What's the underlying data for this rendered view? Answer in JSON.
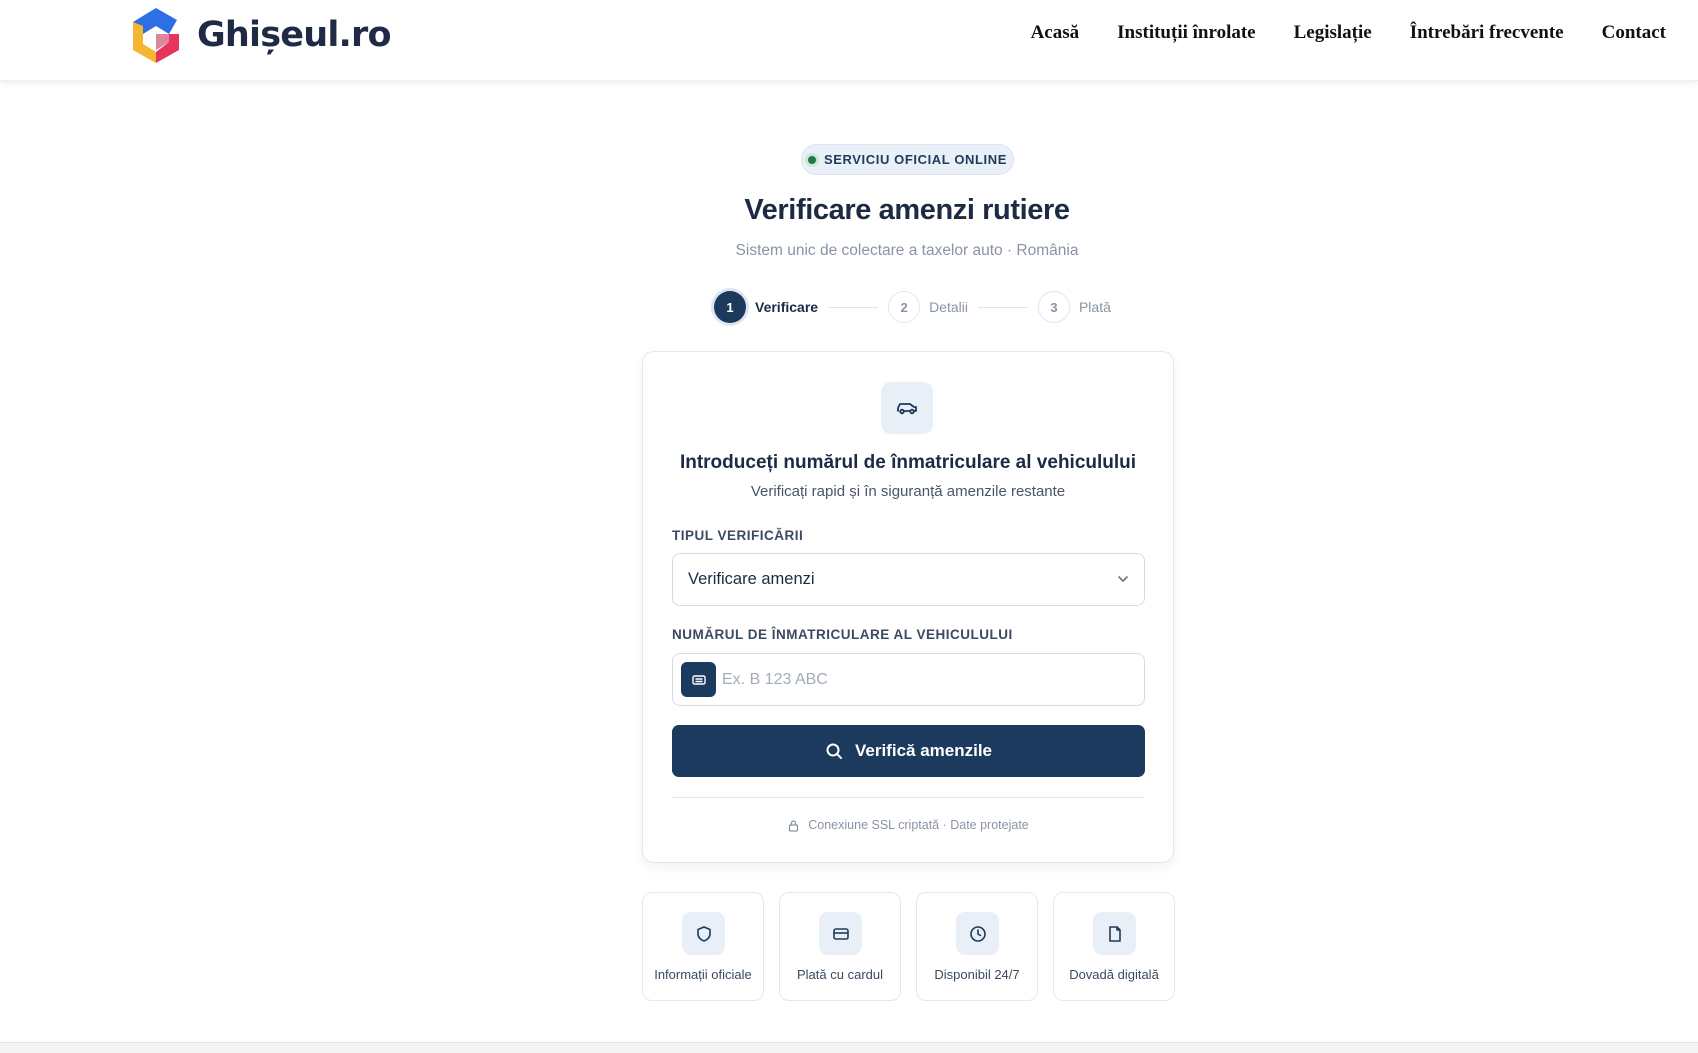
{
  "header": {
    "logo_text": "Ghișeul.ro",
    "nav": [
      "Acasă",
      "Instituții înrolate",
      "Legislație",
      "Întrebări frecvente",
      "Contact"
    ]
  },
  "hero": {
    "badge": "SERVICIU OFICIAL ONLINE",
    "title": "Verificare amenzi rutiere",
    "subtitle": "Sistem unic de colectare a taxelor auto · România"
  },
  "stepper": [
    {
      "num": "1",
      "label": "Verificare",
      "state": "active"
    },
    {
      "num": "2",
      "label": "Detalii",
      "state": "idle"
    },
    {
      "num": "3",
      "label": "Plată",
      "state": "idle"
    }
  ],
  "card": {
    "icon": "car-icon",
    "title": "Introduceți numărul de înmatriculare al vehiculului",
    "subtitle": "Verificați rapid și în siguranță amenzile restante",
    "type_label": "TIPUL VERIFICĂRII",
    "type_value": "Verificare amenzi",
    "plate_label": "NUMĂRUL DE ÎNMATRICULARE AL VEHICULULUI",
    "plate_value": "",
    "plate_placeholder": "Ex. B 123 ABC",
    "submit_label": "Verifică amenzile",
    "ssl_text": "Conexiune SSL criptată · Date protejate"
  },
  "features": [
    {
      "icon": "shield-icon",
      "label": "Informații oficiale"
    },
    {
      "icon": "credit-card-icon",
      "label": "Plată cu cardul"
    },
    {
      "icon": "clock-icon",
      "label": "Disponibil 24/7"
    },
    {
      "icon": "document-icon",
      "label": "Dovadă digitală"
    }
  ],
  "colors": {
    "primary": "#1c3a5e",
    "badge_dot": "#1e7a46",
    "muted": "#8a94a6"
  }
}
